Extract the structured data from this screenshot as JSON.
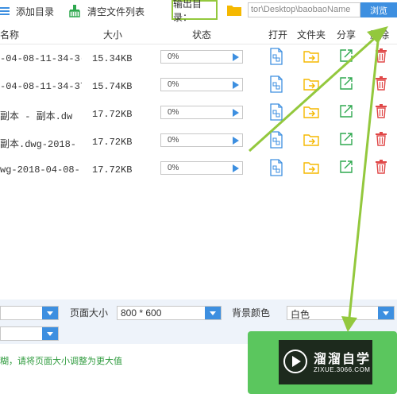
{
  "toolbar": {
    "add_dir_label": "添加目录",
    "clear_list_label": "清空文件列表",
    "output_dir_label": "输出目录：",
    "output_path": "tor\\Desktop\\baobaoName",
    "browse_label": "浏览"
  },
  "table": {
    "headers": {
      "name": "名称",
      "size": "大小",
      "status": "状态",
      "open": "打开",
      "folder": "文件夹",
      "share": "分享",
      "delete": "删除"
    },
    "rows": [
      {
        "name": "-04-08-11-34-3(",
        "size": "15.34KB",
        "progress_text": "0%",
        "progress": 0
      },
      {
        "name": "-04-08-11-34-37",
        "size": "15.74KB",
        "progress_text": "0%",
        "progress": 0
      },
      {
        "name": " 副本 - 副本.dw",
        "size": "17.72KB",
        "progress_text": "0%",
        "progress": 0
      },
      {
        "name": " 副本.dwg-2018-",
        "size": "17.72KB",
        "progress_text": "0%",
        "progress": 0
      },
      {
        "name": "wg-2018-04-08-",
        "size": "17.72KB",
        "progress_text": "0%",
        "progress": 0
      }
    ]
  },
  "settings": {
    "page_size_label": "页面大小",
    "page_size_value": "800 * 600",
    "bg_color_label": "背景颜色",
    "bg_color_value": "白色"
  },
  "hint_text": "糊，请将页面大小调整为更大值",
  "watermark": {
    "title": "溜溜自学",
    "subtitle": "ZIXUE.3066.COM"
  },
  "colors": {
    "accent_blue": "#3d8fe0",
    "folder_yellow": "#f5b800",
    "share_green": "#2fa84f",
    "delete_red": "#e04848",
    "annotation_green": "#93c83d",
    "convert_green": "#5bc65e"
  },
  "icons": {
    "add_dir": "list-icon",
    "clear_list": "broom-icon",
    "output_folder": "folder-icon",
    "open": "file-open-icon",
    "folder": "folder-arrow-icon",
    "share": "share-icon",
    "delete": "trash-icon"
  }
}
